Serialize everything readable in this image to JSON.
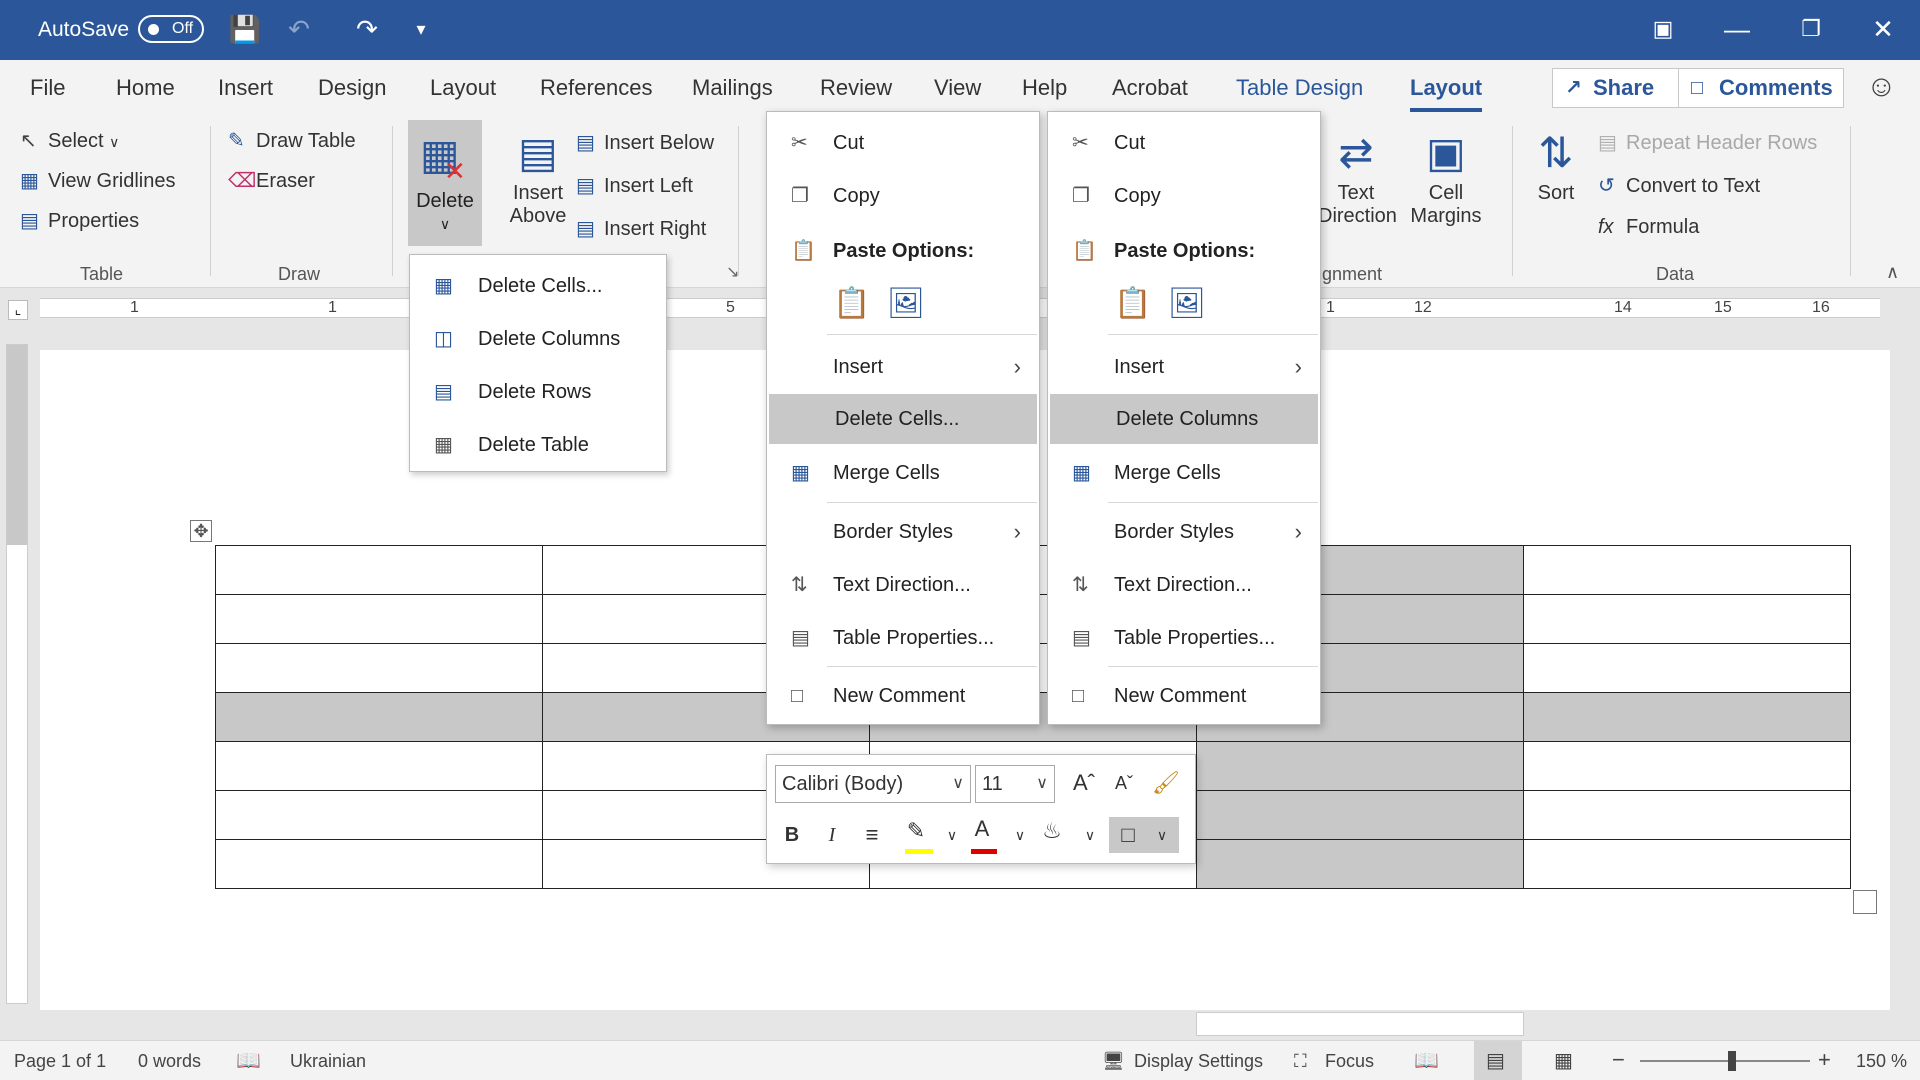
{
  "titlebar": {
    "autosave_label": "AutoSave",
    "autosave_state": "Off",
    "icons": [
      "save-icon",
      "undo-icon",
      "redo-icon",
      "customize-icon",
      "ribbon-display-icon",
      "minimize-icon",
      "restore-icon",
      "close-icon"
    ]
  },
  "tabs": [
    "File",
    "Home",
    "Insert",
    "Design",
    "Layout",
    "References",
    "Mailings",
    "Review",
    "View",
    "Help",
    "Acrobat",
    "Table Design",
    "Layout"
  ],
  "active_tab": "Layout",
  "share_label": "Share",
  "comments_label": "Comments",
  "ribbon": {
    "table_group": {
      "select": "Select",
      "view_gridlines": "View Gridlines",
      "properties": "Properties",
      "label": "Table"
    },
    "draw_group": {
      "draw_table": "Draw Table",
      "eraser": "Eraser",
      "label": "Draw"
    },
    "delete_label": "Delete",
    "insert_above_1": "Insert",
    "insert_above_2": "Above",
    "insert_below": "Insert Below",
    "insert_left": "Insert Left",
    "insert_right": "Insert Right",
    "text_direction_1": "Text",
    "text_direction_2": "Direction",
    "cell_margins_1": "Cell",
    "cell_margins_2": "Margins",
    "alignment_label": "gnment",
    "sort": "Sort",
    "repeat_header_rows": "Repeat Header Rows",
    "convert_to_text": "Convert to Text",
    "formula": "Formula",
    "data_label": "Data"
  },
  "ruler": {
    "numbers": [
      "1",
      "1",
      "5",
      "1",
      "12",
      "14",
      "15",
      "16"
    ]
  },
  "delete_menu": [
    "Delete Cells...",
    "Delete Columns",
    "Delete Rows",
    "Delete Table"
  ],
  "context_menu_left": {
    "cut": "Cut",
    "copy": "Copy",
    "paste_options": "Paste Options:",
    "insert": "Insert",
    "highlighted": "Delete Cells...",
    "merge_cells": "Merge Cells",
    "border_styles": "Border Styles",
    "text_direction": "Text Direction...",
    "table_properties": "Table Properties...",
    "new_comment": "New Comment"
  },
  "context_menu_right": {
    "cut": "Cut",
    "copy": "Copy",
    "paste_options": "Paste Options:",
    "insert": "Insert",
    "highlighted": "Delete Columns",
    "merge_cells": "Merge Cells",
    "border_styles": "Border Styles",
    "text_direction": "Text Direction...",
    "table_properties": "Table Properties...",
    "new_comment": "New Comment"
  },
  "mini_toolbar": {
    "font": "Calibri (Body)",
    "size": "11",
    "bold": "B",
    "italic": "I"
  },
  "statusbar": {
    "page": "Page 1 of 1",
    "words": "0 words",
    "language": "Ukrainian",
    "display_settings": "Display Settings",
    "focus": "Focus",
    "zoom_minus": "−",
    "zoom_plus": "+",
    "zoom": "150 %"
  },
  "colors": {
    "titlebar": "#2b579a",
    "selection": "#c8c8c8",
    "highlight_yellow": "#ffff00",
    "font_red": "#e00000"
  }
}
